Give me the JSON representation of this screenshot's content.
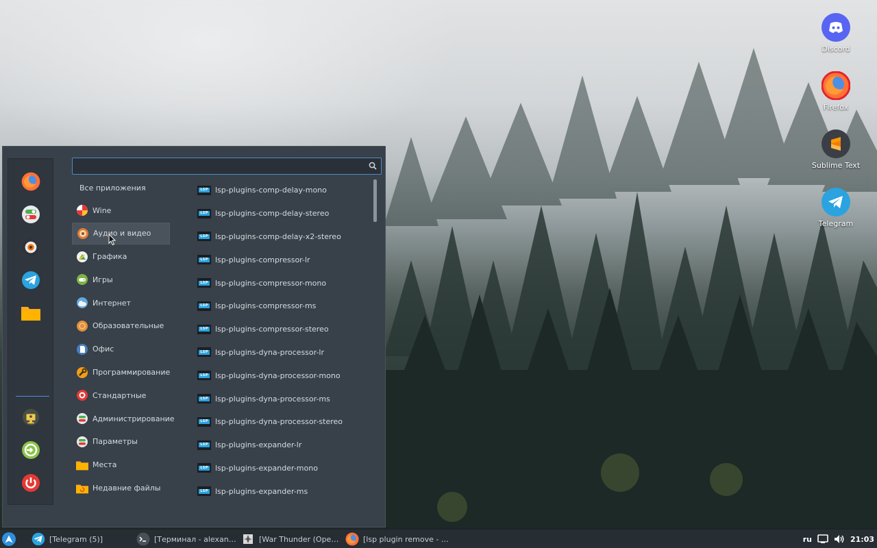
{
  "desktop": {
    "icons": [
      {
        "label": "Discord",
        "icon": "discord-icon",
        "color": "#5865f2"
      },
      {
        "label": "Firefox",
        "icon": "firefox-icon",
        "color": "#e66000"
      },
      {
        "label": "Sublime Text",
        "icon": "sublime-text-icon",
        "color": "#ff9800"
      },
      {
        "label": "Telegram",
        "icon": "telegram-icon",
        "color": "#2aa3e0"
      }
    ]
  },
  "menu": {
    "search": {
      "value": "",
      "placeholder": ""
    },
    "favorites": [
      {
        "icon": "firefox-icon"
      },
      {
        "icon": "settings-toggle-icon"
      },
      {
        "icon": "obs-icon"
      },
      {
        "icon": "telegram-icon"
      },
      {
        "icon": "folder-icon"
      }
    ],
    "session": [
      {
        "icon": "lock-screen-icon"
      },
      {
        "icon": "logout-icon"
      },
      {
        "icon": "power-icon"
      }
    ],
    "all_apps_label": "Все приложения",
    "categories": [
      {
        "label": "Wine",
        "icon": "wine-icon"
      },
      {
        "label": "Аудио и видео",
        "icon": "audio-video-icon",
        "selected": true
      },
      {
        "label": "Графика",
        "icon": "graphics-icon"
      },
      {
        "label": "Игры",
        "icon": "games-icon"
      },
      {
        "label": "Интернет",
        "icon": "internet-icon"
      },
      {
        "label": "Образовательные",
        "icon": "education-icon"
      },
      {
        "label": "Офис",
        "icon": "office-icon"
      },
      {
        "label": "Программирование",
        "icon": "programming-icon"
      },
      {
        "label": "Стандартные",
        "icon": "accessories-icon"
      },
      {
        "label": "Администрирование",
        "icon": "administration-icon"
      },
      {
        "label": "Параметры",
        "icon": "preferences-icon"
      },
      {
        "label": "Места",
        "icon": "places-folder-icon"
      },
      {
        "label": "Недавние файлы",
        "icon": "recent-files-icon"
      }
    ],
    "lsp_badge": "LSP",
    "apps": [
      "lsp-plugins-comp-delay-mono",
      "lsp-plugins-comp-delay-stereo",
      "lsp-plugins-comp-delay-x2-stereo",
      "lsp-plugins-compressor-lr",
      "lsp-plugins-compressor-mono",
      "lsp-plugins-compressor-ms",
      "lsp-plugins-compressor-stereo",
      "lsp-plugins-dyna-processor-lr",
      "lsp-plugins-dyna-processor-mono",
      "lsp-plugins-dyna-processor-ms",
      "lsp-plugins-dyna-processor-stereo",
      "lsp-plugins-expander-lr",
      "lsp-plugins-expander-mono",
      "lsp-plugins-expander-ms"
    ]
  },
  "taskbar": {
    "tasks": [
      {
        "label": "[Telegram (5)]",
        "icon": "telegram-icon"
      },
      {
        "label": "[Терминал - alexan…",
        "icon": "terminal-icon"
      },
      {
        "label": "[War Thunder (Ope…",
        "icon": "war-thunder-icon"
      },
      {
        "label": "[lsp plugin remove - …",
        "icon": "firefox-icon"
      }
    ],
    "tray": {
      "language": "ru",
      "clock": "21:03"
    }
  },
  "colors": {
    "accent": "#4d8cc9",
    "menu_bg": "#384049",
    "taskbar_bg": "#262d33"
  }
}
